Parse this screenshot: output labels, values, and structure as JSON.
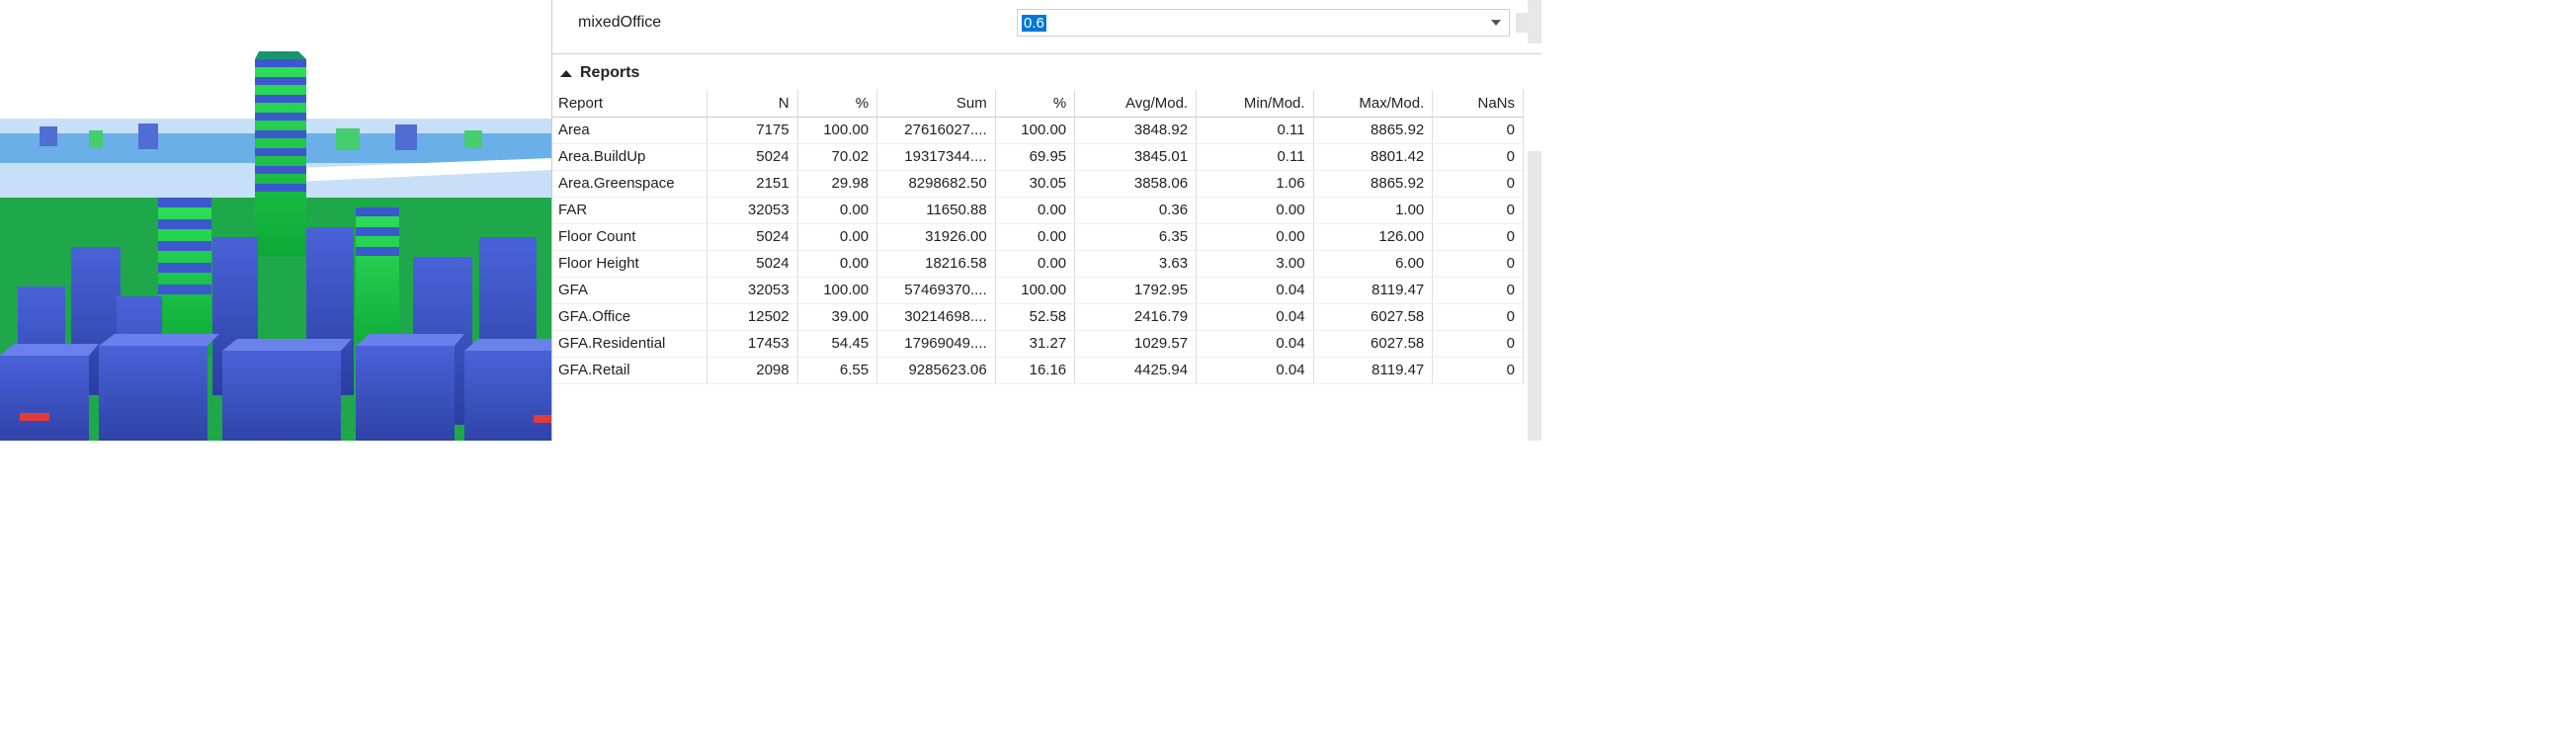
{
  "property": {
    "label": "mixedOffice",
    "value": "0.6"
  },
  "sectionTitle": "Reports",
  "columns": [
    "Report",
    "N",
    "%",
    "Sum",
    "%",
    "Avg/Mod.",
    "Min/Mod.",
    "Max/Mod.",
    "NaNs"
  ],
  "rows": [
    {
      "name": "Area",
      "n": "7175",
      "pct1": "100.00",
      "sum": "27616027....",
      "pct2": "100.00",
      "avg": "3848.92",
      "min": "0.11",
      "max": "8865.92",
      "nans": "0"
    },
    {
      "name": "Area.BuildUp",
      "n": "5024",
      "pct1": "70.02",
      "sum": "19317344....",
      "pct2": "69.95",
      "avg": "3845.01",
      "min": "0.11",
      "max": "8801.42",
      "nans": "0"
    },
    {
      "name": "Area.Greenspace",
      "n": "2151",
      "pct1": "29.98",
      "sum": "8298682.50",
      "pct2": "30.05",
      "avg": "3858.06",
      "min": "1.06",
      "max": "8865.92",
      "nans": "0"
    },
    {
      "name": "FAR",
      "n": "32053",
      "pct1": "0.00",
      "sum": "11650.88",
      "pct2": "0.00",
      "avg": "0.36",
      "min": "0.00",
      "max": "1.00",
      "nans": "0"
    },
    {
      "name": "Floor Count",
      "n": "5024",
      "pct1": "0.00",
      "sum": "31926.00",
      "pct2": "0.00",
      "avg": "6.35",
      "min": "0.00",
      "max": "126.00",
      "nans": "0"
    },
    {
      "name": "Floor Height",
      "n": "5024",
      "pct1": "0.00",
      "sum": "18216.58",
      "pct2": "0.00",
      "avg": "3.63",
      "min": "3.00",
      "max": "6.00",
      "nans": "0"
    },
    {
      "name": "GFA",
      "n": "32053",
      "pct1": "100.00",
      "sum": "57469370....",
      "pct2": "100.00",
      "avg": "1792.95",
      "min": "0.04",
      "max": "8119.47",
      "nans": "0"
    },
    {
      "name": "GFA.Office",
      "n": "12502",
      "pct1": "39.00",
      "sum": "30214698....",
      "pct2": "52.58",
      "avg": "2416.79",
      "min": "0.04",
      "max": "6027.58",
      "nans": "0"
    },
    {
      "name": "GFA.Residential",
      "n": "17453",
      "pct1": "54.45",
      "sum": "17969049....",
      "pct2": "31.27",
      "avg": "1029.57",
      "min": "0.04",
      "max": "6027.58",
      "nans": "0"
    },
    {
      "name": "GFA.Retail",
      "n": "2098",
      "pct1": "6.55",
      "sum": "9285623.06",
      "pct2": "16.16",
      "avg": "4425.94",
      "min": "0.04",
      "max": "8119.47",
      "nans": "0"
    }
  ]
}
